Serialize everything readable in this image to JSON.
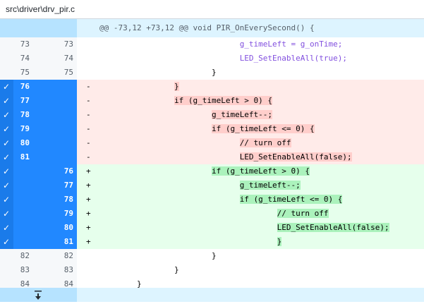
{
  "file_path": "src\\driver\\drv_pir.c",
  "hunk_header": "@@ -73,12 +73,12 @@ void PIR_OnEverySecond() {",
  "icons": {
    "expand_up": "expand-up-icon",
    "expand_down": "expand-down-icon",
    "check": "checkmark-icon"
  },
  "rows": [
    {
      "type": "ctx",
      "old": "73",
      "new": "73",
      "marker": "",
      "indent": "                              ",
      "code": "g_timeLeft = g_onTime;"
    },
    {
      "type": "ctx",
      "old": "74",
      "new": "74",
      "marker": "",
      "indent": "                              ",
      "code": "LED_SetEnableAll(true);"
    },
    {
      "type": "ctx",
      "old": "75",
      "new": "75",
      "marker": "",
      "indent": "                        ",
      "code": "}"
    },
    {
      "type": "del",
      "old": "76",
      "new": "",
      "marker": "-",
      "indent": "                ",
      "code": "}"
    },
    {
      "type": "del",
      "old": "77",
      "new": "",
      "marker": "-",
      "indent": "                ",
      "code": "if (g_timeLeft > 0) {"
    },
    {
      "type": "del",
      "old": "78",
      "new": "",
      "marker": "-",
      "indent": "                        ",
      "code": "g_timeLeft--;"
    },
    {
      "type": "del",
      "old": "79",
      "new": "",
      "marker": "-",
      "indent": "                        ",
      "code": "if (g_timeLeft <= 0) {"
    },
    {
      "type": "del",
      "old": "80",
      "new": "",
      "marker": "-",
      "indent": "                              ",
      "code": "// turn off"
    },
    {
      "type": "del",
      "old": "81",
      "new": "",
      "marker": "-",
      "indent": "                              ",
      "code": "LED_SetEnableAll(false);"
    },
    {
      "type": "add",
      "old": "",
      "new": "76",
      "marker": "+",
      "indent": "                        ",
      "code": "if (g_timeLeft > 0) {"
    },
    {
      "type": "add",
      "old": "",
      "new": "77",
      "marker": "+",
      "indent": "                              ",
      "code": "g_timeLeft--;"
    },
    {
      "type": "add",
      "old": "",
      "new": "78",
      "marker": "+",
      "indent": "                              ",
      "code": "if (g_timeLeft <= 0) {"
    },
    {
      "type": "add",
      "old": "",
      "new": "79",
      "marker": "+",
      "indent": "                                      ",
      "code": "// turn off"
    },
    {
      "type": "add",
      "old": "",
      "new": "80",
      "marker": "+",
      "indent": "                                      ",
      "code": "LED_SetEnableAll(false);"
    },
    {
      "type": "add",
      "old": "",
      "new": "81",
      "marker": "+",
      "indent": "                                      ",
      "code": "}"
    },
    {
      "type": "ctx",
      "old": "82",
      "new": "82",
      "marker": "",
      "indent": "                        ",
      "code": "}"
    },
    {
      "type": "ctx",
      "old": "83",
      "new": "83",
      "marker": "",
      "indent": "                ",
      "code": "}"
    },
    {
      "type": "ctx",
      "old": "84",
      "new": "84",
      "marker": "",
      "indent": "        ",
      "code": "}"
    }
  ]
}
